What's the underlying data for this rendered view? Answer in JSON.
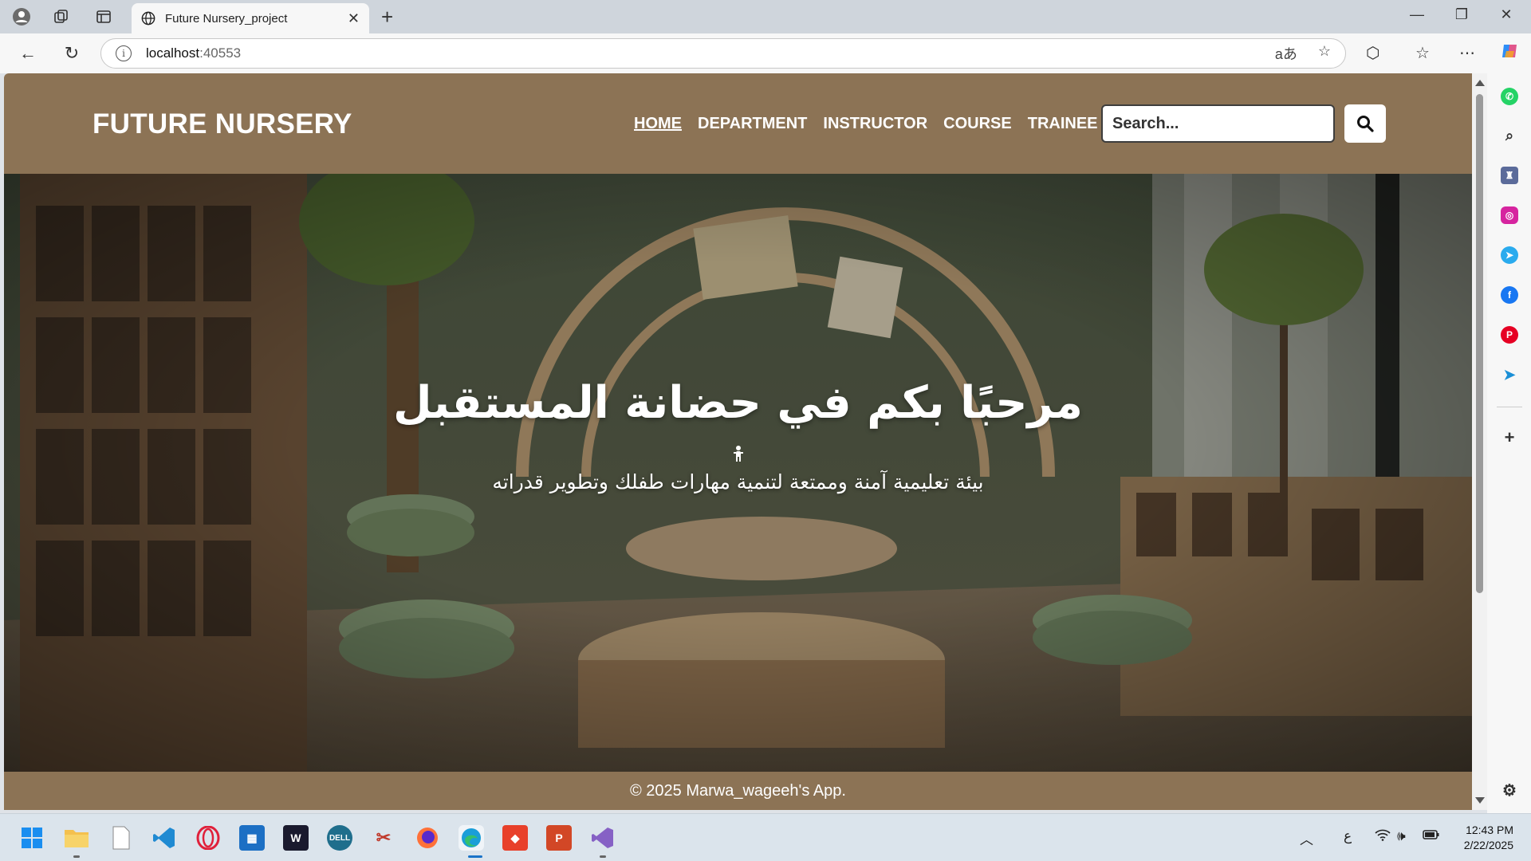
{
  "browser": {
    "tab_title": "Future Nursery_project",
    "url_host": "localhost",
    "url_port": ":40553"
  },
  "site": {
    "brand": "FUTURE NURSERY",
    "nav": [
      {
        "label": "HOME",
        "active": true
      },
      {
        "label": "DEPARTMENT",
        "active": false
      },
      {
        "label": "INSTRUCTOR",
        "active": false
      },
      {
        "label": "COURSE",
        "active": false
      },
      {
        "label": "TRAINEE",
        "active": false
      }
    ],
    "search_placeholder": "Search...",
    "hero_title": "مرحبًا بكم في حضانة المستقبل",
    "hero_subtitle": "بيئة تعليمية آمنة وممتعة لتنمية مهارات طفلك وتطوير قدراته",
    "footer": "© 2025 Marwa_wageeh's App."
  },
  "colors": {
    "header_bg": "#8c7355",
    "accent": "#ffffff"
  },
  "sidebar_icons": [
    "whatsapp-icon",
    "search-icon",
    "games-icon",
    "instagram-icon",
    "telegram-icon",
    "facebook-icon",
    "pinterest-icon",
    "send-icon",
    "add-icon",
    "settings-icon"
  ],
  "taskbar": {
    "apps": [
      "start-icon",
      "file-explorer-icon",
      "notepad-icon",
      "vscode-icon",
      "opera-icon",
      "store-icon",
      "waves-icon",
      "dell-icon",
      "snipping-tool-icon",
      "firefox-icon",
      "edge-icon",
      "anydesk-icon",
      "powerpoint-icon",
      "visual-studio-icon"
    ],
    "language": "ع",
    "time": "12:43 PM",
    "date": "2/22/2025"
  }
}
